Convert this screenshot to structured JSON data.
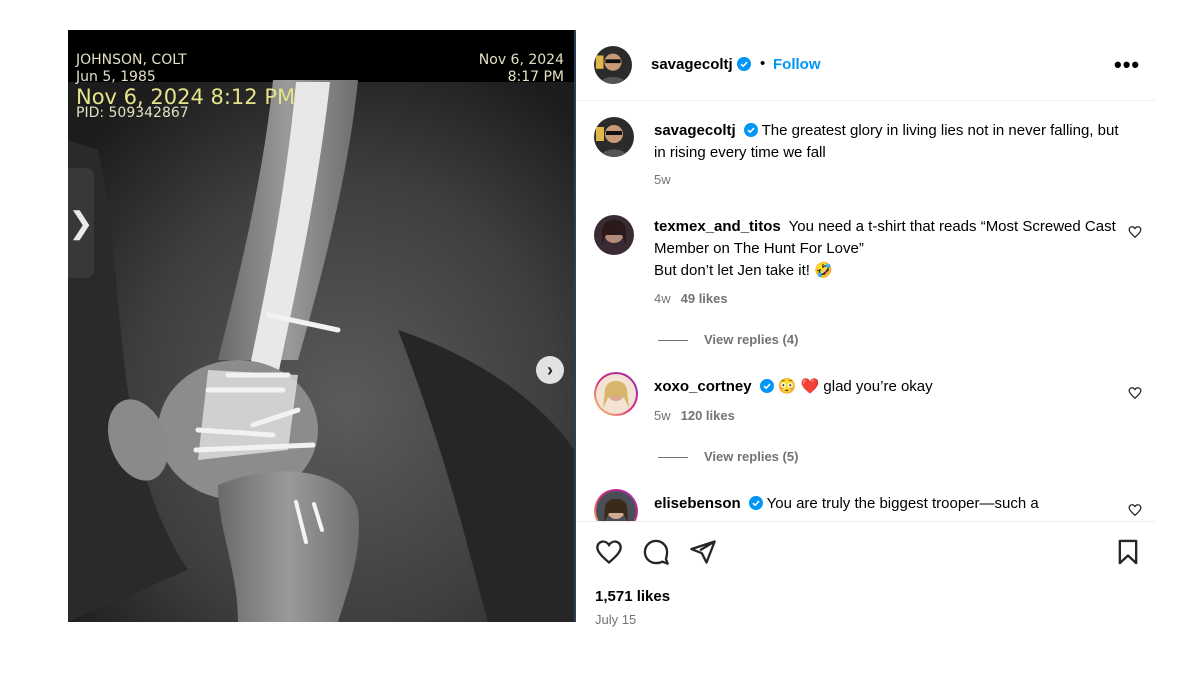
{
  "media": {
    "overlay": {
      "patient_name": "JOHNSON, COLT",
      "dob": "Jun 5, 1985",
      "timestamp": "Nov 6, 2024 8:12 PM",
      "pid": "PID: 509342867",
      "study_date": "Nov 6, 2024",
      "study_time": "8:17 PM"
    },
    "prev_icon": "chevron-left-icon",
    "next_icon": "chevron-right-icon",
    "prev_glyph": "❯",
    "next_glyph": "›"
  },
  "header": {
    "username": "savagecoltj",
    "separator": "•",
    "follow_label": "Follow",
    "more_label": "•••"
  },
  "caption": {
    "username": "savagecoltj",
    "text": "The greatest glory in living lies not in never falling, but in rising every time we fall",
    "time": "5w"
  },
  "comments": [
    {
      "username": "texmex_and_titos",
      "text_line1": "You need a t-shirt that reads “Most Screwed Cast Member on The Hunt For Love”",
      "text_line2": "But don’t let Jen take it! 🤣",
      "time": "4w",
      "likes": "49 likes",
      "replies": "View replies (4)"
    },
    {
      "username": "xoxo_cortney",
      "text": "😳 ❤️ glad you’re okay",
      "time": "5w",
      "likes": "120 likes",
      "replies": "View replies (5)"
    },
    {
      "username": "elisebenson",
      "text": "You are truly the biggest trooper—such a"
    }
  ],
  "actions": {
    "likes": "1,571 likes",
    "date": "July 15"
  },
  "colors": {
    "follow_blue": "#0095f6",
    "verified_blue": "#0095f6",
    "muted": "#737373"
  }
}
